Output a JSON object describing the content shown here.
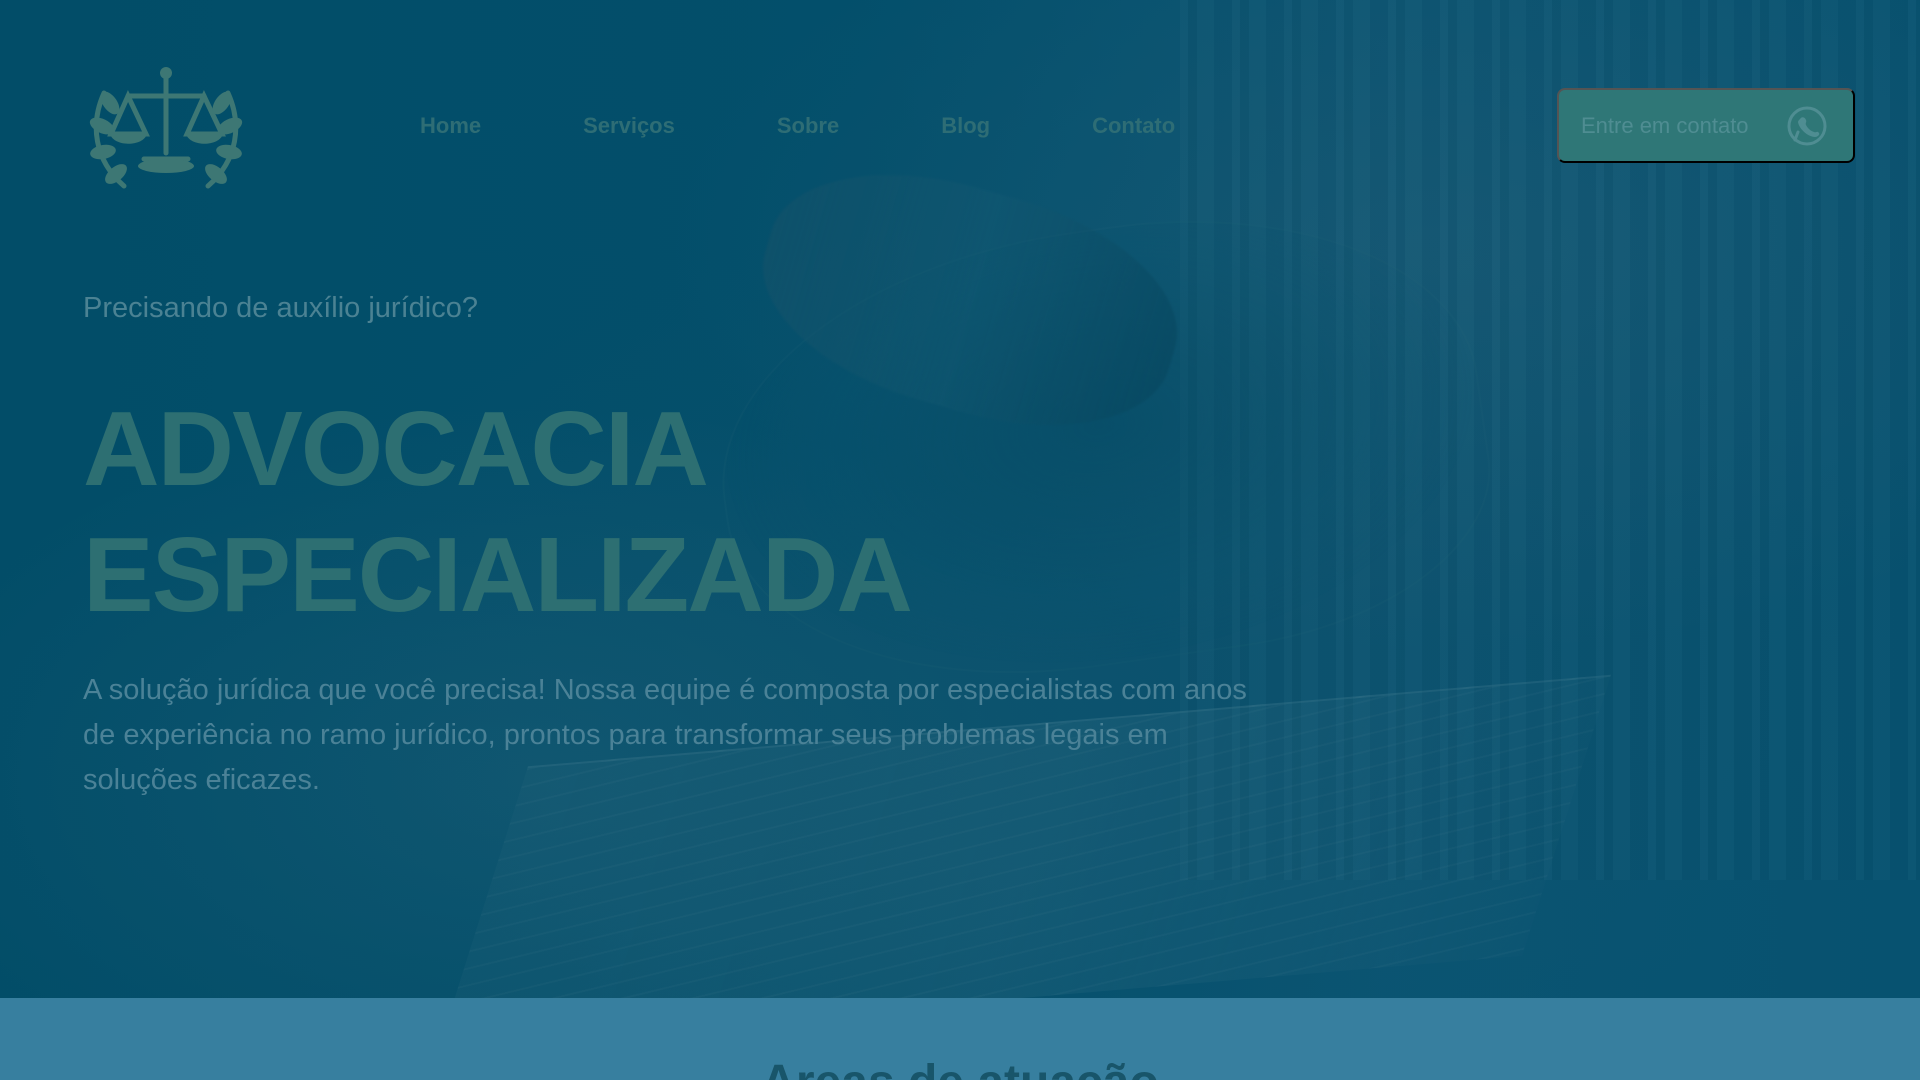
{
  "navigation": {
    "items": [
      {
        "label": "Home"
      },
      {
        "label": "Serviços"
      },
      {
        "label": "Sobre"
      },
      {
        "label": "Blog"
      },
      {
        "label": "Contato"
      }
    ]
  },
  "header": {
    "cta_label": "Entre em contato",
    "cta_icon": "whatsapp-icon"
  },
  "hero": {
    "kicker": "Precisando de auxílio jurídico?",
    "title_line_1": "ADVOCACIA",
    "title_line_2": "ESPECIALIZADA",
    "description": "A solução jurídica que você precisa! Nossa equipe é composta por especialistas com anos de experiência no ramo jurídico, prontos para transformar seus problemas legais em soluções eficazes."
  },
  "next_section": {
    "title": "Areas de atuação"
  },
  "icons": {
    "logo": "scales-of-justice-laurel-icon",
    "cta": "whatsapp-icon"
  },
  "colors": {
    "hero_overlay": "#064e6c",
    "accent_button": "#2f7777",
    "section_band": "#377f9f"
  }
}
